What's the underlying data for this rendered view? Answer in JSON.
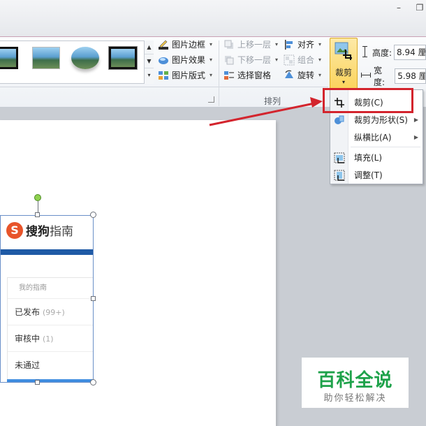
{
  "ribbon": {
    "picture_styles": {
      "border": "图片边框",
      "effects": "图片效果",
      "layout": "图片版式"
    },
    "arrange": {
      "bring_forward": "上移一层",
      "send_backward": "下移一层",
      "selection_pane": "选择窗格",
      "align": "对齐",
      "group": "组合",
      "rotate": "旋转",
      "group_label": "排列"
    },
    "crop": {
      "label": "裁剪"
    },
    "size": {
      "height_label": "高度:",
      "height_value": "8.94 厘",
      "width_label": "宽度:",
      "width_value": "5.98 厘"
    }
  },
  "crop_menu": {
    "items": [
      {
        "label": "裁剪(C)",
        "icon": "crop-icon"
      },
      {
        "label": "裁剪为形状(S)",
        "icon": "crop-to-shape-icon",
        "submenu": true
      },
      {
        "label": "纵横比(A)",
        "icon": "",
        "submenu": true
      },
      {
        "label": "填充(L)",
        "icon": "fill-icon"
      },
      {
        "label": "调整(T)",
        "icon": "fit-icon"
      }
    ]
  },
  "slide_picture": {
    "logo_s": "S",
    "logo_brand": "搜狗",
    "logo_suffix": "指南",
    "card_title": "我的指南",
    "rows": [
      {
        "label": "已发布",
        "count": "(99+)"
      },
      {
        "label": "审核中",
        "count": "(1)"
      },
      {
        "label": "未通过",
        "count": ""
      }
    ]
  },
  "watermark": {
    "title": "百科全说",
    "subtitle": "助你轻松解决"
  },
  "window": {
    "minimize": "–",
    "restore": "❐"
  },
  "colors": {
    "accent_red": "#d3242d",
    "crop_button": "#fbd45c",
    "watermark_green": "#1ea24a",
    "brand_blue": "#1f5aa6"
  }
}
